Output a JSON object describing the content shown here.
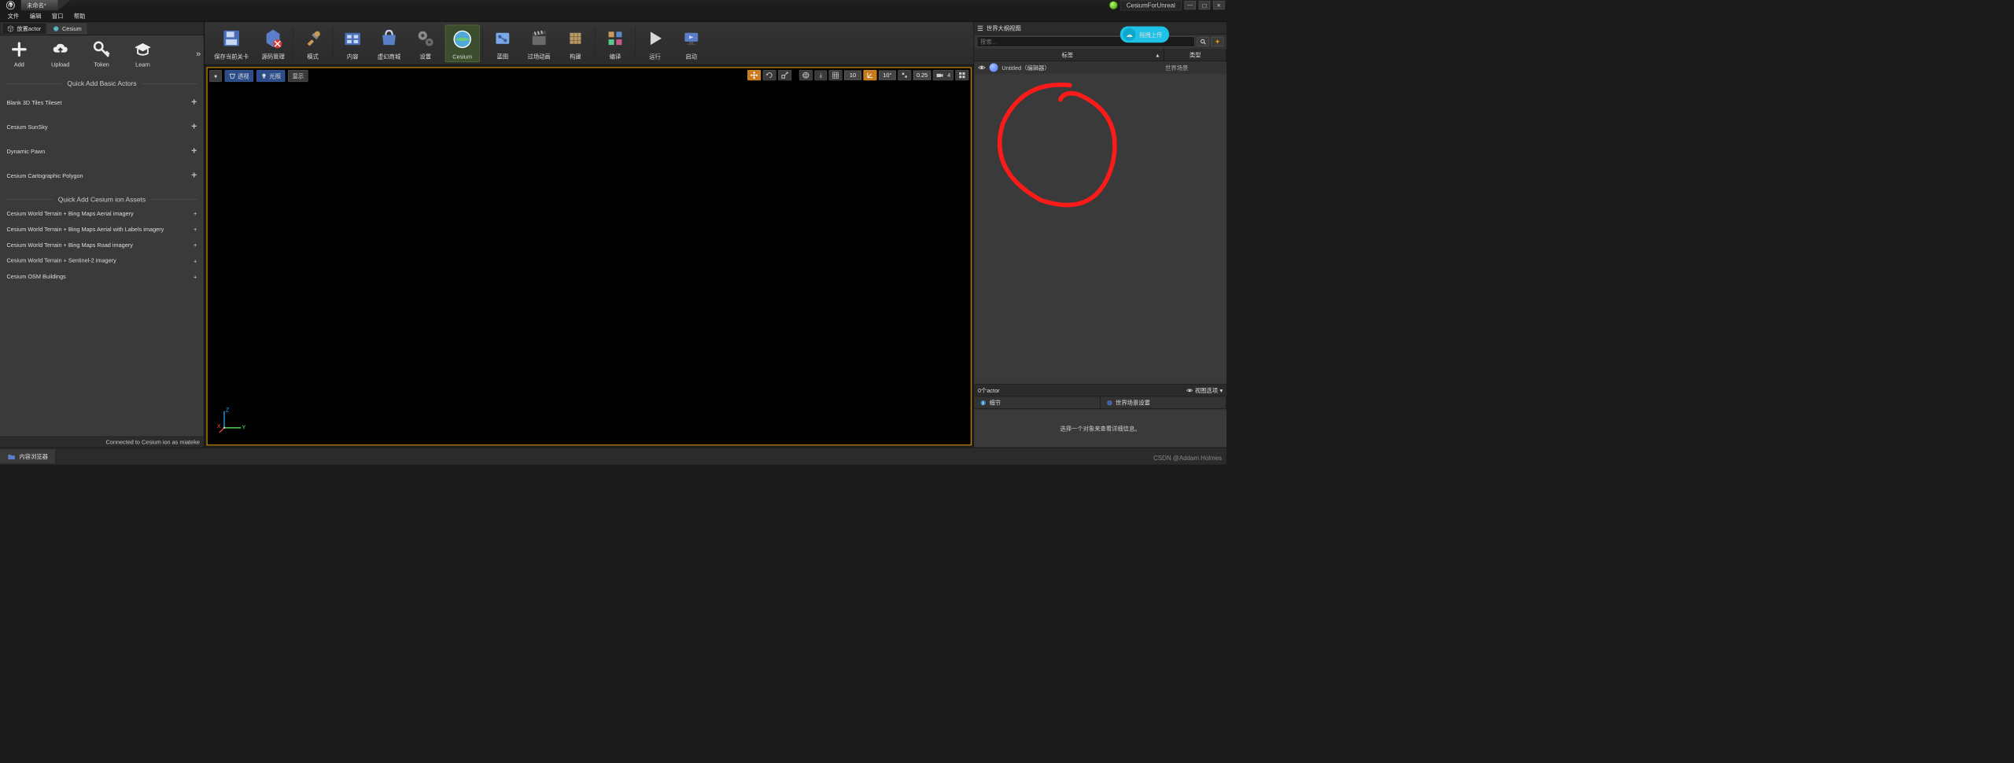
{
  "titlebar": {
    "doc": "未命名*",
    "product": "CesiumForUnreal"
  },
  "menu": {
    "file": "文件",
    "edit": "编辑",
    "window": "窗口",
    "help": "帮助"
  },
  "sidebar": {
    "tabs": {
      "place": "放置actor",
      "cesium": "Cesium"
    },
    "buttons": {
      "add": "Add",
      "upload": "Upload",
      "token": "Token",
      "learn": "Learn"
    },
    "section_actors": "Quick Add Basic Actors",
    "actors": [
      "Blank 3D Tiles Tileset",
      "Cesium SunSky",
      "Dynamic Pawn",
      "Cesium Cartographic Polygon"
    ],
    "section_assets": "Quick Add Cesium ion Assets",
    "assets": [
      "Cesium World Terrain + Bing Maps Aerial imagery",
      "Cesium World Terrain + Bing Maps Aerial with Labels imagery",
      "Cesium World Terrain + Bing Maps Road imagery",
      "Cesium World Terrain + Sentinel-2 imagery",
      "Cesium OSM Buildings"
    ],
    "connection": "Connected to Cesium ion as miateke"
  },
  "toolbar": {
    "save": "保存当前关卡",
    "source": "源码管理",
    "mode": "模式",
    "content": "内容",
    "market": "虚幻商城",
    "settings": "设置",
    "cesium": "Cesium",
    "blueprint": "蓝图",
    "cinematic": "过场动画",
    "build": "构建",
    "compile": "编译",
    "play": "运行",
    "launch": "启动"
  },
  "viewport": {
    "perspective": "透视",
    "lit": "光照",
    "show": "显示",
    "snap_pos": "10",
    "snap_rot": "10°",
    "snap_scale": "0.25",
    "cam_speed": "4"
  },
  "outliner": {
    "title": "世界大纲视图",
    "search_ph": "搜索...",
    "col_label": "标签",
    "col_type": "类型",
    "row": {
      "name": "Untitled（编辑器）",
      "type": "世界场景"
    },
    "count": "0个actor",
    "viewopts": "视图选项"
  },
  "details": {
    "tab1": "细节",
    "tab2": "世界场景设置",
    "empty": "选择一个对象来查看详细信息。"
  },
  "content_browser": {
    "tab": "内容浏览器"
  },
  "upload_badge": "拖拽上传",
  "watermark": "CSDN @Addam Holmes"
}
